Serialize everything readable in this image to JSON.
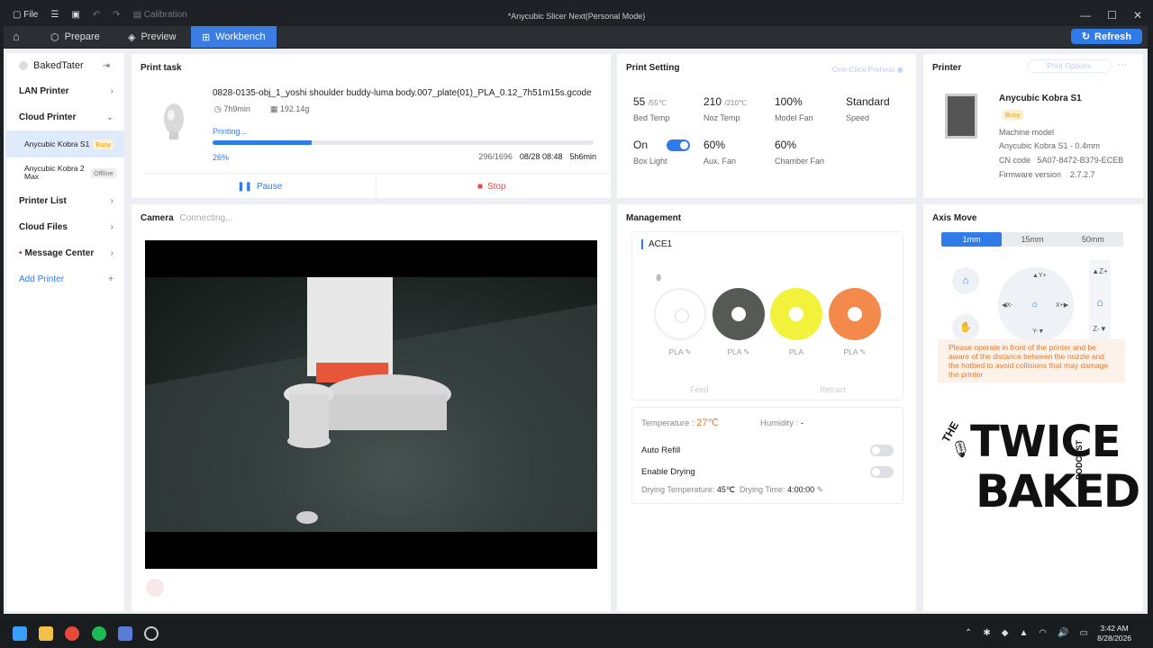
{
  "titlebar": {
    "file": "File",
    "calibration": "Calibration",
    "title": "*Anycubic Slicer Next(Personal Mode)"
  },
  "nav": {
    "tabs": [
      "Prepare",
      "Preview",
      "Workbench"
    ],
    "refresh": "Refresh"
  },
  "sidebar": {
    "user": "BakedTater",
    "lan_printer": "LAN Printer",
    "cloud_printer": "Cloud Printer",
    "printers": [
      {
        "name": "Anycubic Kobra S1",
        "status": "Busy"
      },
      {
        "name": "Anycubic Kobra 2 Max",
        "status": "Offline"
      }
    ],
    "printer_list": "Printer List",
    "cloud_files": "Cloud Files",
    "message_center": "Message Center",
    "add_printer": "Add Printer"
  },
  "print_task": {
    "title": "Print task",
    "filename": "0828-0135-obj_1_yoshi shoulder buddy-luma body.007_plate(01)_PLA_0.12_7h51m15s.gcode",
    "duration": "7h9min",
    "weight": "192.14g",
    "status": "Printing...",
    "progress": 0.26,
    "progress_label": "26%",
    "layers": "296/1696",
    "eta": "08/28 08:48",
    "remaining": "5h6min",
    "pause": "Pause",
    "stop": "Stop"
  },
  "camera": {
    "title": "Camera",
    "status": "Connecting..."
  },
  "print_setting": {
    "title": "Print Setting",
    "preheat": "One-Click Preheat",
    "bed_temp": "55",
    "bed_target": "/55℃",
    "bed_label": "Bed Temp",
    "noz_temp": "210",
    "noz_target": "/210℃",
    "noz_label": "Noz Temp",
    "model_fan": "100%",
    "model_fan_label": "Model Fan",
    "speed": "Standard",
    "speed_label": "Speed",
    "box_light": "On",
    "box_light_label": "Box Light",
    "aux_fan": "60%",
    "aux_fan_label": "Aux. Fan",
    "chamber_fan": "60%",
    "chamber_fan_label": "Chamber Fan"
  },
  "printer": {
    "title": "Printer",
    "options": "Print Options",
    "name": "Anycubic Kobra S1",
    "status": "Busy",
    "machine_model_label": "Machine model",
    "machine_model": "Anycubic Kobra S1 - 0.4mm",
    "cn_label": "CN code",
    "cn_code": "5A07-8472-B379-ECEB",
    "fw_label": "Firmware version",
    "fw": "2.7.2.7"
  },
  "management": {
    "title": "Management",
    "ace": "ACE1",
    "spools": [
      {
        "label": "PLA",
        "color": "#ffffff"
      },
      {
        "label": "PLA",
        "color": "#555a55"
      },
      {
        "label": "PLA",
        "color": "#f2f23c"
      },
      {
        "label": "PLA",
        "color": "#f3894a"
      }
    ],
    "feed": "Feed",
    "retract": "Retract",
    "temperature_label": "Temperature :",
    "temperature": "27℃",
    "humidity_label": "Humidity :",
    "humidity": "-",
    "auto_refill": "Auto Refill",
    "enable_drying": "Enable Drying",
    "drying_temp_label": "Drying Temperature:",
    "drying_temp": "45℃",
    "drying_time_label": "Drying Time:",
    "drying_time": "4:00:00"
  },
  "axis": {
    "title": "Axis Move",
    "steps": [
      "1mm",
      "15mm",
      "50mm"
    ],
    "warning": "Please operate in front of the printer and be aware of the distance between the nozzle and the hotbed to avoid collisions that may damage the printer"
  },
  "logo": {
    "the": "THE",
    "line1": "TWICE",
    "line2": "BAKED",
    "podcast": "PODCAST"
  },
  "taskbar": {
    "time": "3:42 AM",
    "date": "8/28/2026"
  },
  "colors": {
    "accent": "#2f7be8",
    "warning": "#e07a2f",
    "stop": "#e34b4b"
  }
}
